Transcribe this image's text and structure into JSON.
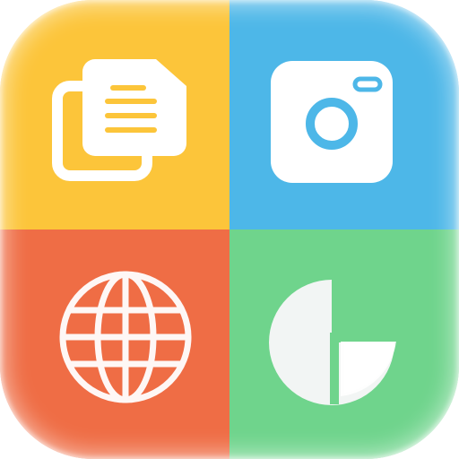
{
  "colors": {
    "documents": "#FCC53A",
    "camera": "#4DB7E8",
    "browser": "#EF6D45",
    "charts": "#6FD48C",
    "glyph": "#FFFFFF",
    "glyph_soft": "#F2F5F4",
    "text_lines": "#FCC53A",
    "lens": "#4DB7E8"
  },
  "tiles": [
    {
      "id": "documents",
      "icon": "documents-icon"
    },
    {
      "id": "camera",
      "icon": "camera-icon"
    },
    {
      "id": "browser",
      "icon": "globe-icon"
    },
    {
      "id": "charts",
      "icon": "pie-chart-icon"
    }
  ]
}
